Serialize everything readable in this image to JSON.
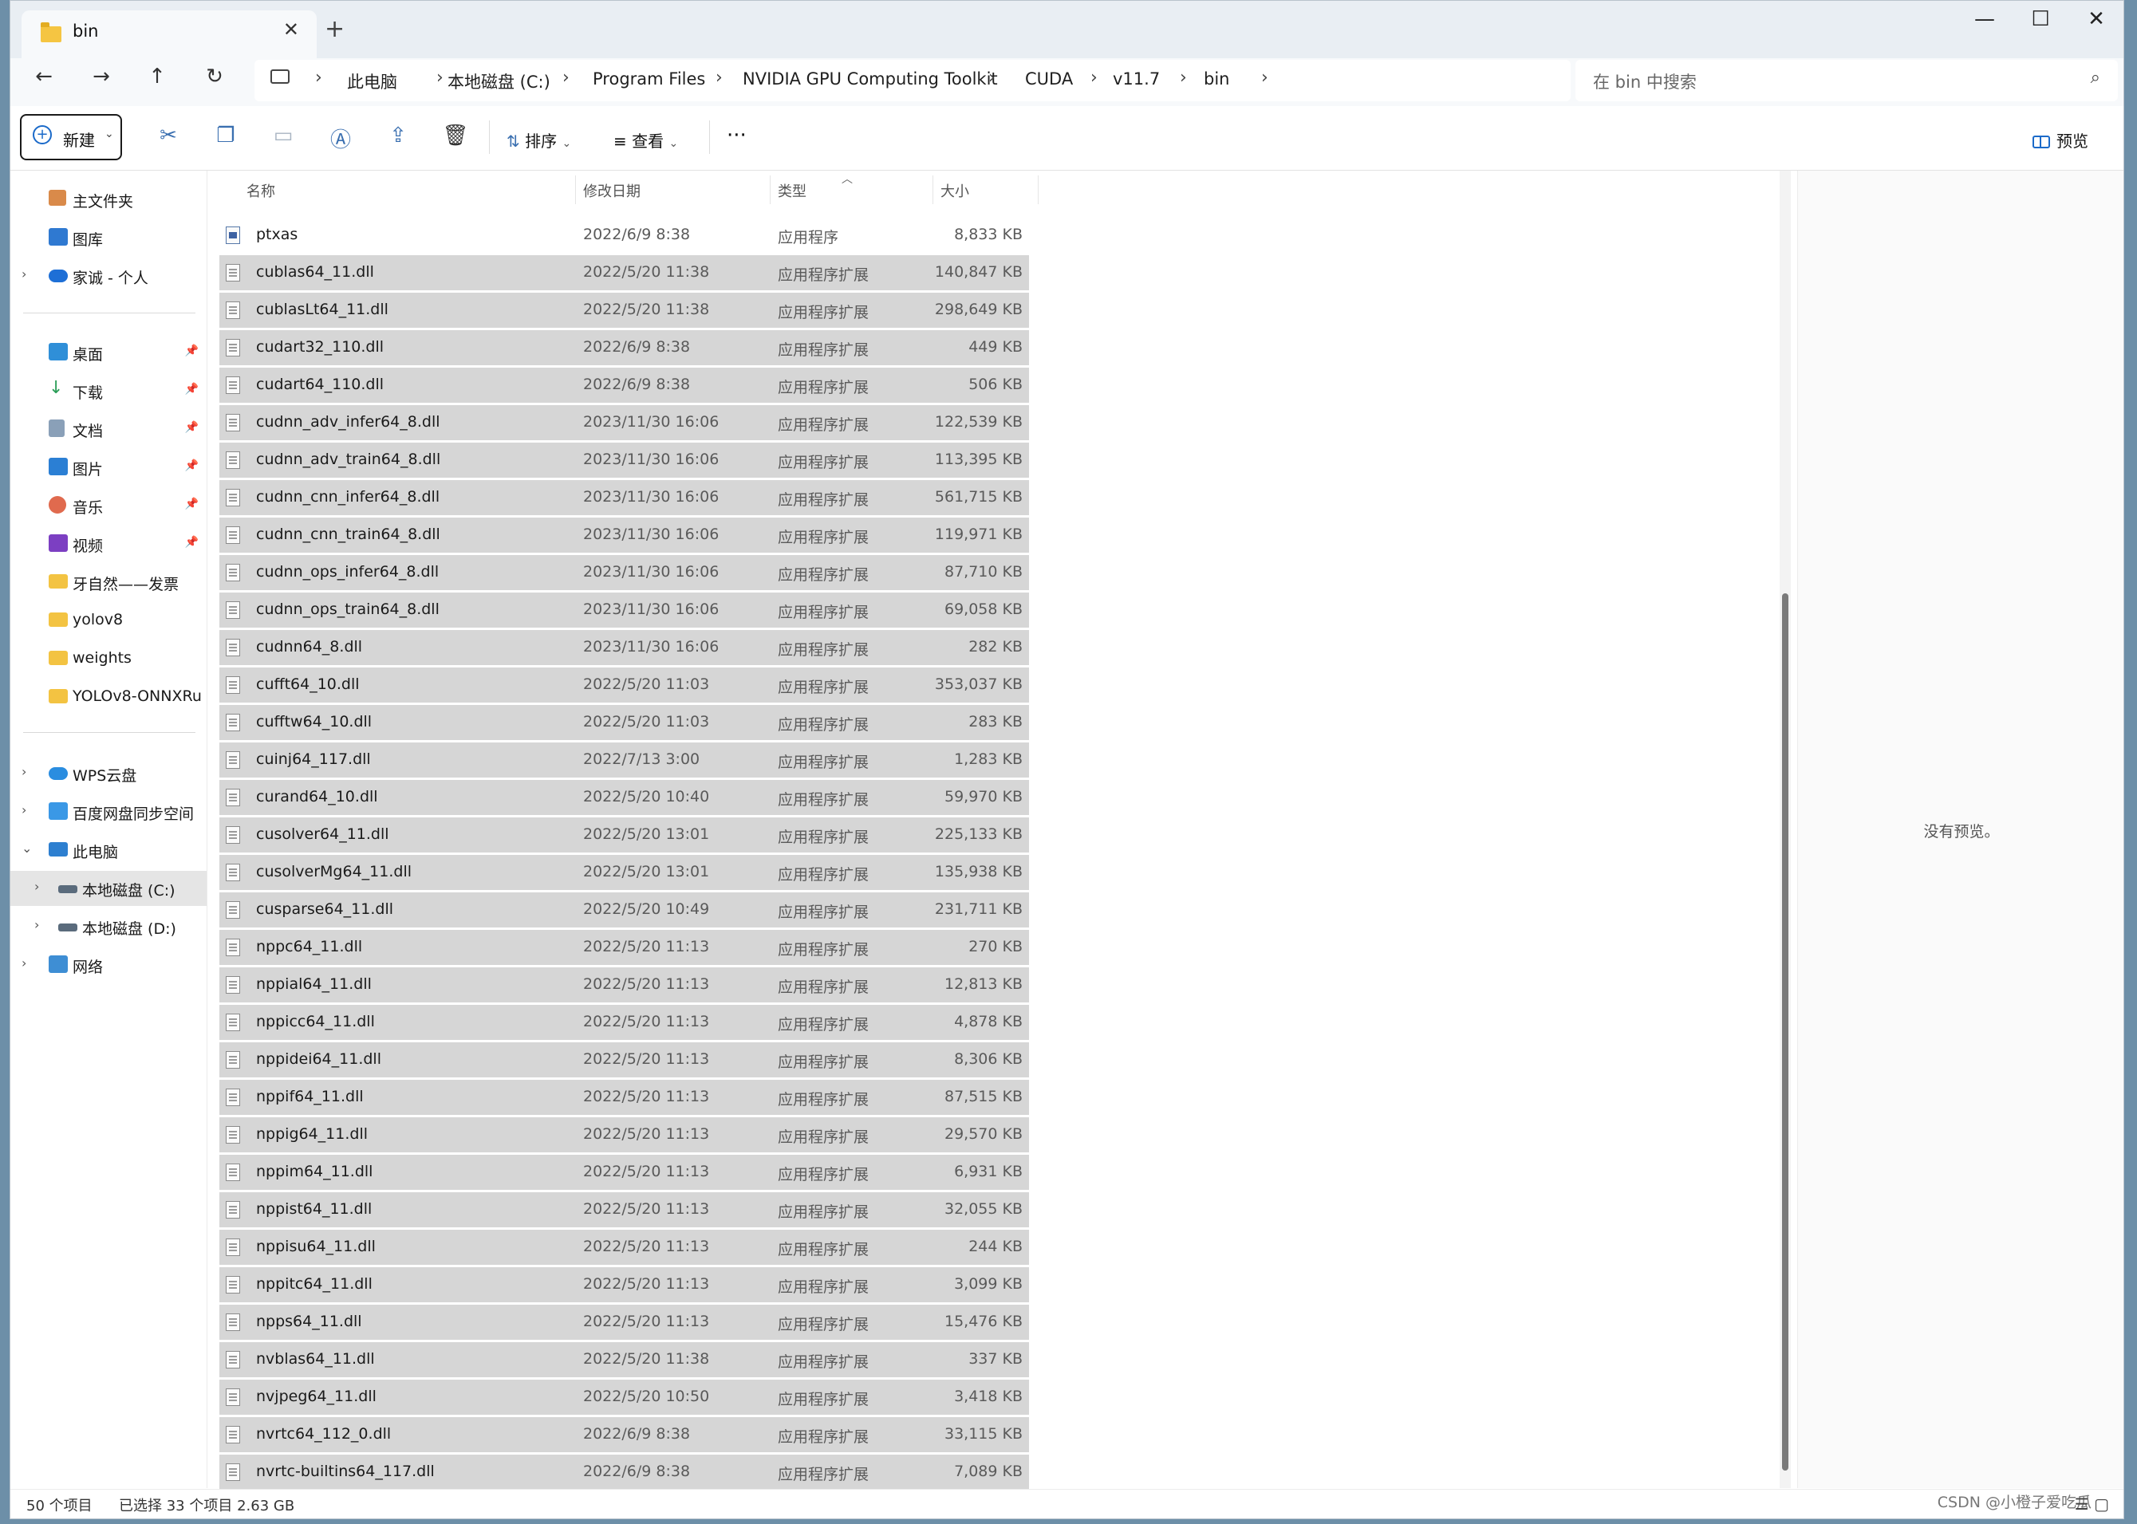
{
  "tab": {
    "title": "bin"
  },
  "window_controls": {
    "minimize": "—",
    "maximize": "☐",
    "close": "✕"
  },
  "breadcrumb": [
    "此电脑",
    "本地磁盘 (C:)",
    "Program Files",
    "NVIDIA GPU Computing Toolkit",
    "CUDA",
    "v11.7",
    "bin"
  ],
  "search": {
    "placeholder": "在 bin 中搜索"
  },
  "toolbar": {
    "new_label": "新建",
    "sort_label": "排序",
    "view_label": "查看",
    "more_label": "···",
    "preview_label": "预览"
  },
  "sidebar": {
    "top": [
      {
        "label": "主文件夹",
        "icon": "home-icon"
      },
      {
        "label": "图库",
        "icon": "gallery-icon"
      },
      {
        "label": "家诚 - 个人",
        "icon": "cloud-icon"
      }
    ],
    "quick": [
      {
        "label": "桌面",
        "icon": "desktop-icon",
        "pinned": true
      },
      {
        "label": "下载",
        "icon": "download-icon",
        "pinned": true
      },
      {
        "label": "文档",
        "icon": "document-icon",
        "pinned": true
      },
      {
        "label": "图片",
        "icon": "pictures-icon",
        "pinned": true
      },
      {
        "label": "音乐",
        "icon": "music-icon",
        "pinned": true
      },
      {
        "label": "视频",
        "icon": "video-icon",
        "pinned": true
      },
      {
        "label": "牙自然——发票",
        "icon": "folder-icon"
      },
      {
        "label": "yolov8",
        "icon": "folder-icon"
      },
      {
        "label": "weights",
        "icon": "folder-icon"
      },
      {
        "label": "YOLOv8-ONNXRu",
        "icon": "folder-icon"
      }
    ],
    "drives": [
      {
        "label": "WPS云盘",
        "icon": "cloud-icon"
      },
      {
        "label": "百度网盘同步空间",
        "icon": "sync-icon"
      },
      {
        "label": "此电脑",
        "icon": "pc-icon"
      },
      {
        "label": "本地磁盘 (C:)",
        "icon": "drive-icon"
      },
      {
        "label": "本地磁盘 (D:)",
        "icon": "drive-icon"
      },
      {
        "label": "网络",
        "icon": "network-icon"
      }
    ]
  },
  "columns": {
    "name": "名称",
    "date": "修改日期",
    "type": "类型",
    "size": "大小"
  },
  "files": [
    {
      "name": "ptxas",
      "date": "2022/6/9 8:38",
      "type": "应用程序",
      "size": "8,833 KB",
      "selected": false
    },
    {
      "name": "cublas64_11.dll",
      "date": "2022/5/20 11:38",
      "type": "应用程序扩展",
      "size": "140,847 KB",
      "selected": true
    },
    {
      "name": "cublasLt64_11.dll",
      "date": "2022/5/20 11:38",
      "type": "应用程序扩展",
      "size": "298,649 KB",
      "selected": true
    },
    {
      "name": "cudart32_110.dll",
      "date": "2022/6/9 8:38",
      "type": "应用程序扩展",
      "size": "449 KB",
      "selected": true
    },
    {
      "name": "cudart64_110.dll",
      "date": "2022/6/9 8:38",
      "type": "应用程序扩展",
      "size": "506 KB",
      "selected": true
    },
    {
      "name": "cudnn_adv_infer64_8.dll",
      "date": "2023/11/30 16:06",
      "type": "应用程序扩展",
      "size": "122,539 KB",
      "selected": true
    },
    {
      "name": "cudnn_adv_train64_8.dll",
      "date": "2023/11/30 16:06",
      "type": "应用程序扩展",
      "size": "113,395 KB",
      "selected": true
    },
    {
      "name": "cudnn_cnn_infer64_8.dll",
      "date": "2023/11/30 16:06",
      "type": "应用程序扩展",
      "size": "561,715 KB",
      "selected": true
    },
    {
      "name": "cudnn_cnn_train64_8.dll",
      "date": "2023/11/30 16:06",
      "type": "应用程序扩展",
      "size": "119,971 KB",
      "selected": true
    },
    {
      "name": "cudnn_ops_infer64_8.dll",
      "date": "2023/11/30 16:06",
      "type": "应用程序扩展",
      "size": "87,710 KB",
      "selected": true
    },
    {
      "name": "cudnn_ops_train64_8.dll",
      "date": "2023/11/30 16:06",
      "type": "应用程序扩展",
      "size": "69,058 KB",
      "selected": true
    },
    {
      "name": "cudnn64_8.dll",
      "date": "2023/11/30 16:06",
      "type": "应用程序扩展",
      "size": "282 KB",
      "selected": true
    },
    {
      "name": "cufft64_10.dll",
      "date": "2022/5/20 11:03",
      "type": "应用程序扩展",
      "size": "353,037 KB",
      "selected": true
    },
    {
      "name": "cufftw64_10.dll",
      "date": "2022/5/20 11:03",
      "type": "应用程序扩展",
      "size": "283 KB",
      "selected": true
    },
    {
      "name": "cuinj64_117.dll",
      "date": "2022/7/13 3:00",
      "type": "应用程序扩展",
      "size": "1,283 KB",
      "selected": true
    },
    {
      "name": "curand64_10.dll",
      "date": "2022/5/20 10:40",
      "type": "应用程序扩展",
      "size": "59,970 KB",
      "selected": true
    },
    {
      "name": "cusolver64_11.dll",
      "date": "2022/5/20 13:01",
      "type": "应用程序扩展",
      "size": "225,133 KB",
      "selected": true
    },
    {
      "name": "cusolverMg64_11.dll",
      "date": "2022/5/20 13:01",
      "type": "应用程序扩展",
      "size": "135,938 KB",
      "selected": true
    },
    {
      "name": "cusparse64_11.dll",
      "date": "2022/5/20 10:49",
      "type": "应用程序扩展",
      "size": "231,711 KB",
      "selected": true
    },
    {
      "name": "nppc64_11.dll",
      "date": "2022/5/20 11:13",
      "type": "应用程序扩展",
      "size": "270 KB",
      "selected": true
    },
    {
      "name": "nppial64_11.dll",
      "date": "2022/5/20 11:13",
      "type": "应用程序扩展",
      "size": "12,813 KB",
      "selected": true
    },
    {
      "name": "nppicc64_11.dll",
      "date": "2022/5/20 11:13",
      "type": "应用程序扩展",
      "size": "4,878 KB",
      "selected": true
    },
    {
      "name": "nppidei64_11.dll",
      "date": "2022/5/20 11:13",
      "type": "应用程序扩展",
      "size": "8,306 KB",
      "selected": true
    },
    {
      "name": "nppif64_11.dll",
      "date": "2022/5/20 11:13",
      "type": "应用程序扩展",
      "size": "87,515 KB",
      "selected": true
    },
    {
      "name": "nppig64_11.dll",
      "date": "2022/5/20 11:13",
      "type": "应用程序扩展",
      "size": "29,570 KB",
      "selected": true
    },
    {
      "name": "nppim64_11.dll",
      "date": "2022/5/20 11:13",
      "type": "应用程序扩展",
      "size": "6,931 KB",
      "selected": true
    },
    {
      "name": "nppist64_11.dll",
      "date": "2022/5/20 11:13",
      "type": "应用程序扩展",
      "size": "32,055 KB",
      "selected": true
    },
    {
      "name": "nppisu64_11.dll",
      "date": "2022/5/20 11:13",
      "type": "应用程序扩展",
      "size": "244 KB",
      "selected": true
    },
    {
      "name": "nppitc64_11.dll",
      "date": "2022/5/20 11:13",
      "type": "应用程序扩展",
      "size": "3,099 KB",
      "selected": true
    },
    {
      "name": "npps64_11.dll",
      "date": "2022/5/20 11:13",
      "type": "应用程序扩展",
      "size": "15,476 KB",
      "selected": true
    },
    {
      "name": "nvblas64_11.dll",
      "date": "2022/5/20 11:38",
      "type": "应用程序扩展",
      "size": "337 KB",
      "selected": true
    },
    {
      "name": "nvjpeg64_11.dll",
      "date": "2022/5/20 10:50",
      "type": "应用程序扩展",
      "size": "3,418 KB",
      "selected": true
    },
    {
      "name": "nvrtc64_112_0.dll",
      "date": "2022/6/9 8:38",
      "type": "应用程序扩展",
      "size": "33,115 KB",
      "selected": true
    },
    {
      "name": "nvrtc-builtins64_117.dll",
      "date": "2022/6/9 8:38",
      "type": "应用程序扩展",
      "size": "7,089 KB",
      "selected": true
    }
  ],
  "preview": {
    "message": "没有预览。"
  },
  "status": {
    "item_count": "50 个项目",
    "selection": "已选择 33 个项目 2.63 GB"
  },
  "watermark": "CSDN @小橙子爱吃瓜"
}
